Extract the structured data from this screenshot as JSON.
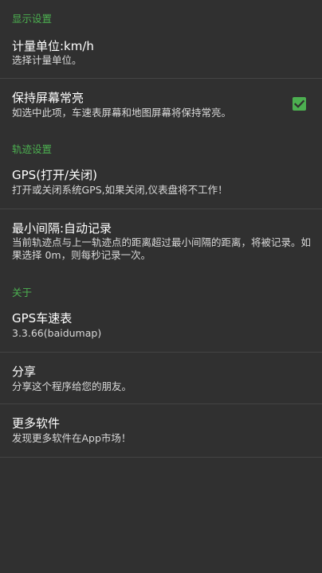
{
  "sections": {
    "display": {
      "header": "显示设置",
      "speed_unit": {
        "title": "计量单位:km/h",
        "summary": "选择计量单位。"
      },
      "keep_screen_on": {
        "title": "保持屏幕常亮",
        "summary": "如选中此项，车速表屏幕和地图屏幕将保持常亮。",
        "checked": true,
        "check_color": "#4caf50"
      }
    },
    "track": {
      "header": "轨迹设置",
      "gps_toggle": {
        "title": "GPS(打开/关闭)",
        "summary": "打开或关闭系统GPS,如果关闭,仪表盘将不工作！"
      },
      "min_interval": {
        "title": "最小间隔:自动记录",
        "summary": "当前轨迹点与上一轨迹点的距离超过最小间隔的距离，将被记录。如果选择 0m，则每秒记录一次。"
      }
    },
    "about": {
      "header": "关于",
      "app": {
        "title": "GPS车速表",
        "summary": "3.3.66(baidumap)"
      },
      "share": {
        "title": "分享",
        "summary": "分享这个程序给您的朋友。"
      },
      "more_apps": {
        "title": "更多软件",
        "summary": "发现更多软件在App市场！"
      }
    }
  },
  "theme": {
    "accent": "#4caf50",
    "background": "#303030",
    "divider": "#444444"
  }
}
